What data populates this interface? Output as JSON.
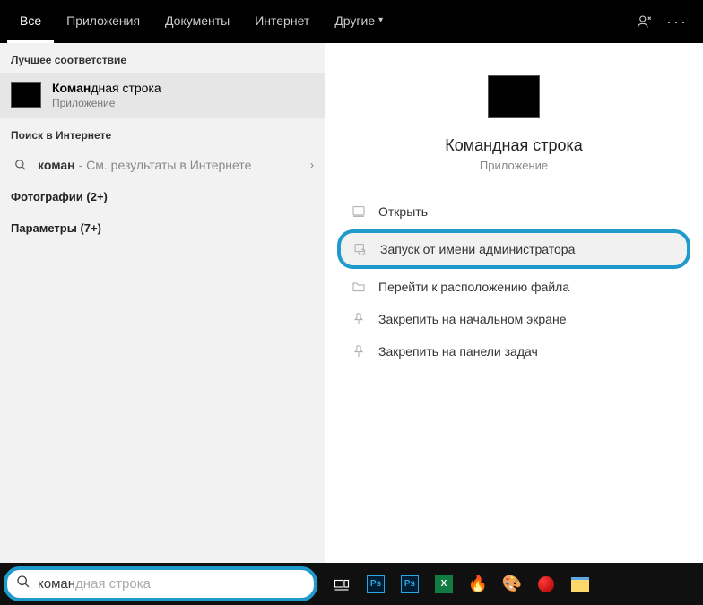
{
  "topbar": {
    "tabs": [
      {
        "label": "Все",
        "active": true
      },
      {
        "label": "Приложения",
        "active": false
      },
      {
        "label": "Документы",
        "active": false
      },
      {
        "label": "Интернет",
        "active": false
      },
      {
        "label": "Другие",
        "active": false,
        "dropdown": true
      }
    ]
  },
  "left": {
    "best_header": "Лучшее соответствие",
    "best": {
      "title_bold": "Коман",
      "title_rest": "дная строка",
      "subtitle": "Приложение"
    },
    "web_header": "Поиск в Интернете",
    "web": {
      "term": "коман",
      "hint": "- См. результаты в Интернете"
    },
    "cats": [
      "Фотографии (2+)",
      "Параметры (7+)"
    ]
  },
  "right": {
    "title": "Командная строка",
    "subtitle": "Приложение",
    "actions": [
      {
        "label": "Открыть",
        "icon": "open"
      },
      {
        "label": "Запуск от имени администратора",
        "icon": "admin",
        "highlight": true
      },
      {
        "label": "Перейти к расположению файла",
        "icon": "folder"
      },
      {
        "label": "Закрепить на начальном экране",
        "icon": "pin-start"
      },
      {
        "label": "Закрепить на панели задач",
        "icon": "pin-taskbar"
      }
    ]
  },
  "search": {
    "typed": "коман",
    "suggestion": "дная строка"
  }
}
